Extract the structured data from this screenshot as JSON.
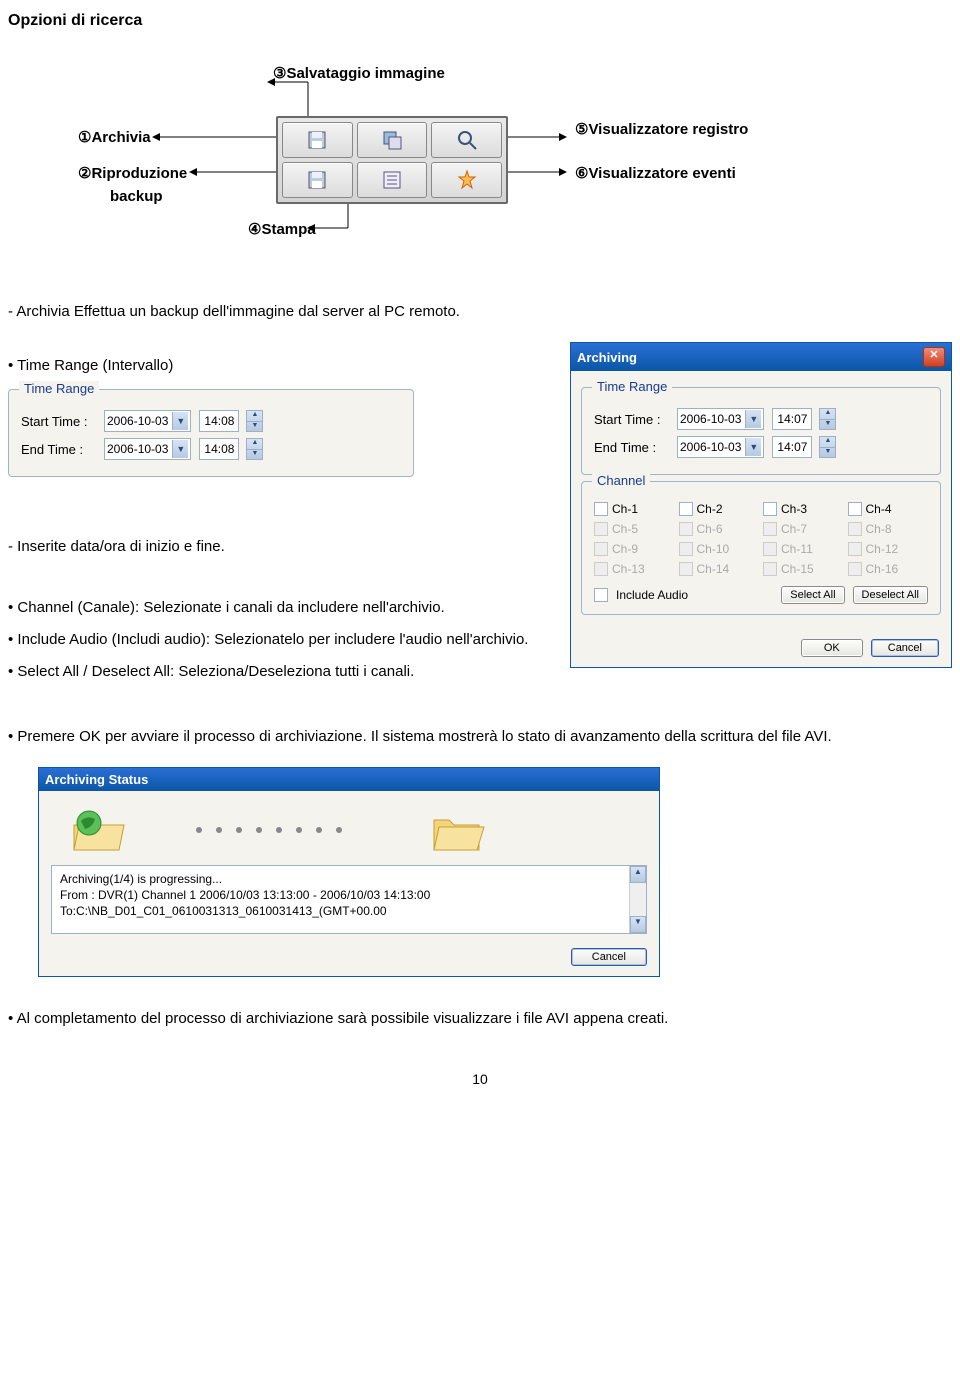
{
  "page_title": "Opzioni di ricerca",
  "diagram": {
    "l1": "①Archivia",
    "l2": "②Riproduzione",
    "l2b": "backup",
    "l3": "③Salvataggio immagine",
    "l4": "④Stampa",
    "l5": "⑤Visualizzatore registro",
    "l6": "⑥Visualizzatore eventi"
  },
  "p_archivia": "-  Archivia Effettua un backup dell'immagine dal server al PC remoto.",
  "p_timerange_heading": "• Time Range (Intervallo)",
  "p_inserite": "- Inserite data/ora di inizio e fine.",
  "p_channel": "• Channel (Canale): Selezionate i canali da includere nell'archivio.",
  "p_includeaudio": "• Include Audio (Includi audio): Selezionatelo per includere l'audio nell'archivio.",
  "p_selectall": "• Select All / Deselect All: Seleziona/Deseleziona tutti i canali.",
  "p_ok": "• Premere OK per avviare il processo di archiviazione.    Il sistema mostrerà lo stato di avanzamento della scrittura del file AVI.",
  "p_completion": "• Al completamento del processo di archiviazione sarà possibile visualizzare i file AVI appena creati.",
  "time_range_group": {
    "legend": "Time Range",
    "start_label": "Start Time :",
    "end_label": "End Time :",
    "date": "2006-10-03",
    "time": "14:08"
  },
  "archiving": {
    "title": "Archiving",
    "time_range_legend": "Time Range",
    "start_label": "Start Time :",
    "end_label": "End Time :",
    "date": "2006-10-03",
    "time": "14:07",
    "channel_legend": "Channel",
    "channels": [
      "Ch-1",
      "Ch-2",
      "Ch-3",
      "Ch-4",
      "Ch-5",
      "Ch-6",
      "Ch-7",
      "Ch-8",
      "Ch-9",
      "Ch-10",
      "Ch-11",
      "Ch-12",
      "Ch-13",
      "Ch-14",
      "Ch-15",
      "Ch-16"
    ],
    "enabled_count": 4,
    "include_audio": "Include Audio",
    "select_all": "Select All",
    "deselect_all": "Deselect All",
    "ok": "OK",
    "cancel": "Cancel"
  },
  "status": {
    "title": "Archiving Status",
    "line1": "Archiving(1/4) is progressing...",
    "line2": "From : DVR(1) Channel 1 2006/10/03 13:13:00 - 2006/10/03 14:13:00",
    "line3": "To:C:\\NB_D01_C01_0610031313_0610031413_(GMT+00.00",
    "cancel": "Cancel"
  },
  "page_number": "10"
}
